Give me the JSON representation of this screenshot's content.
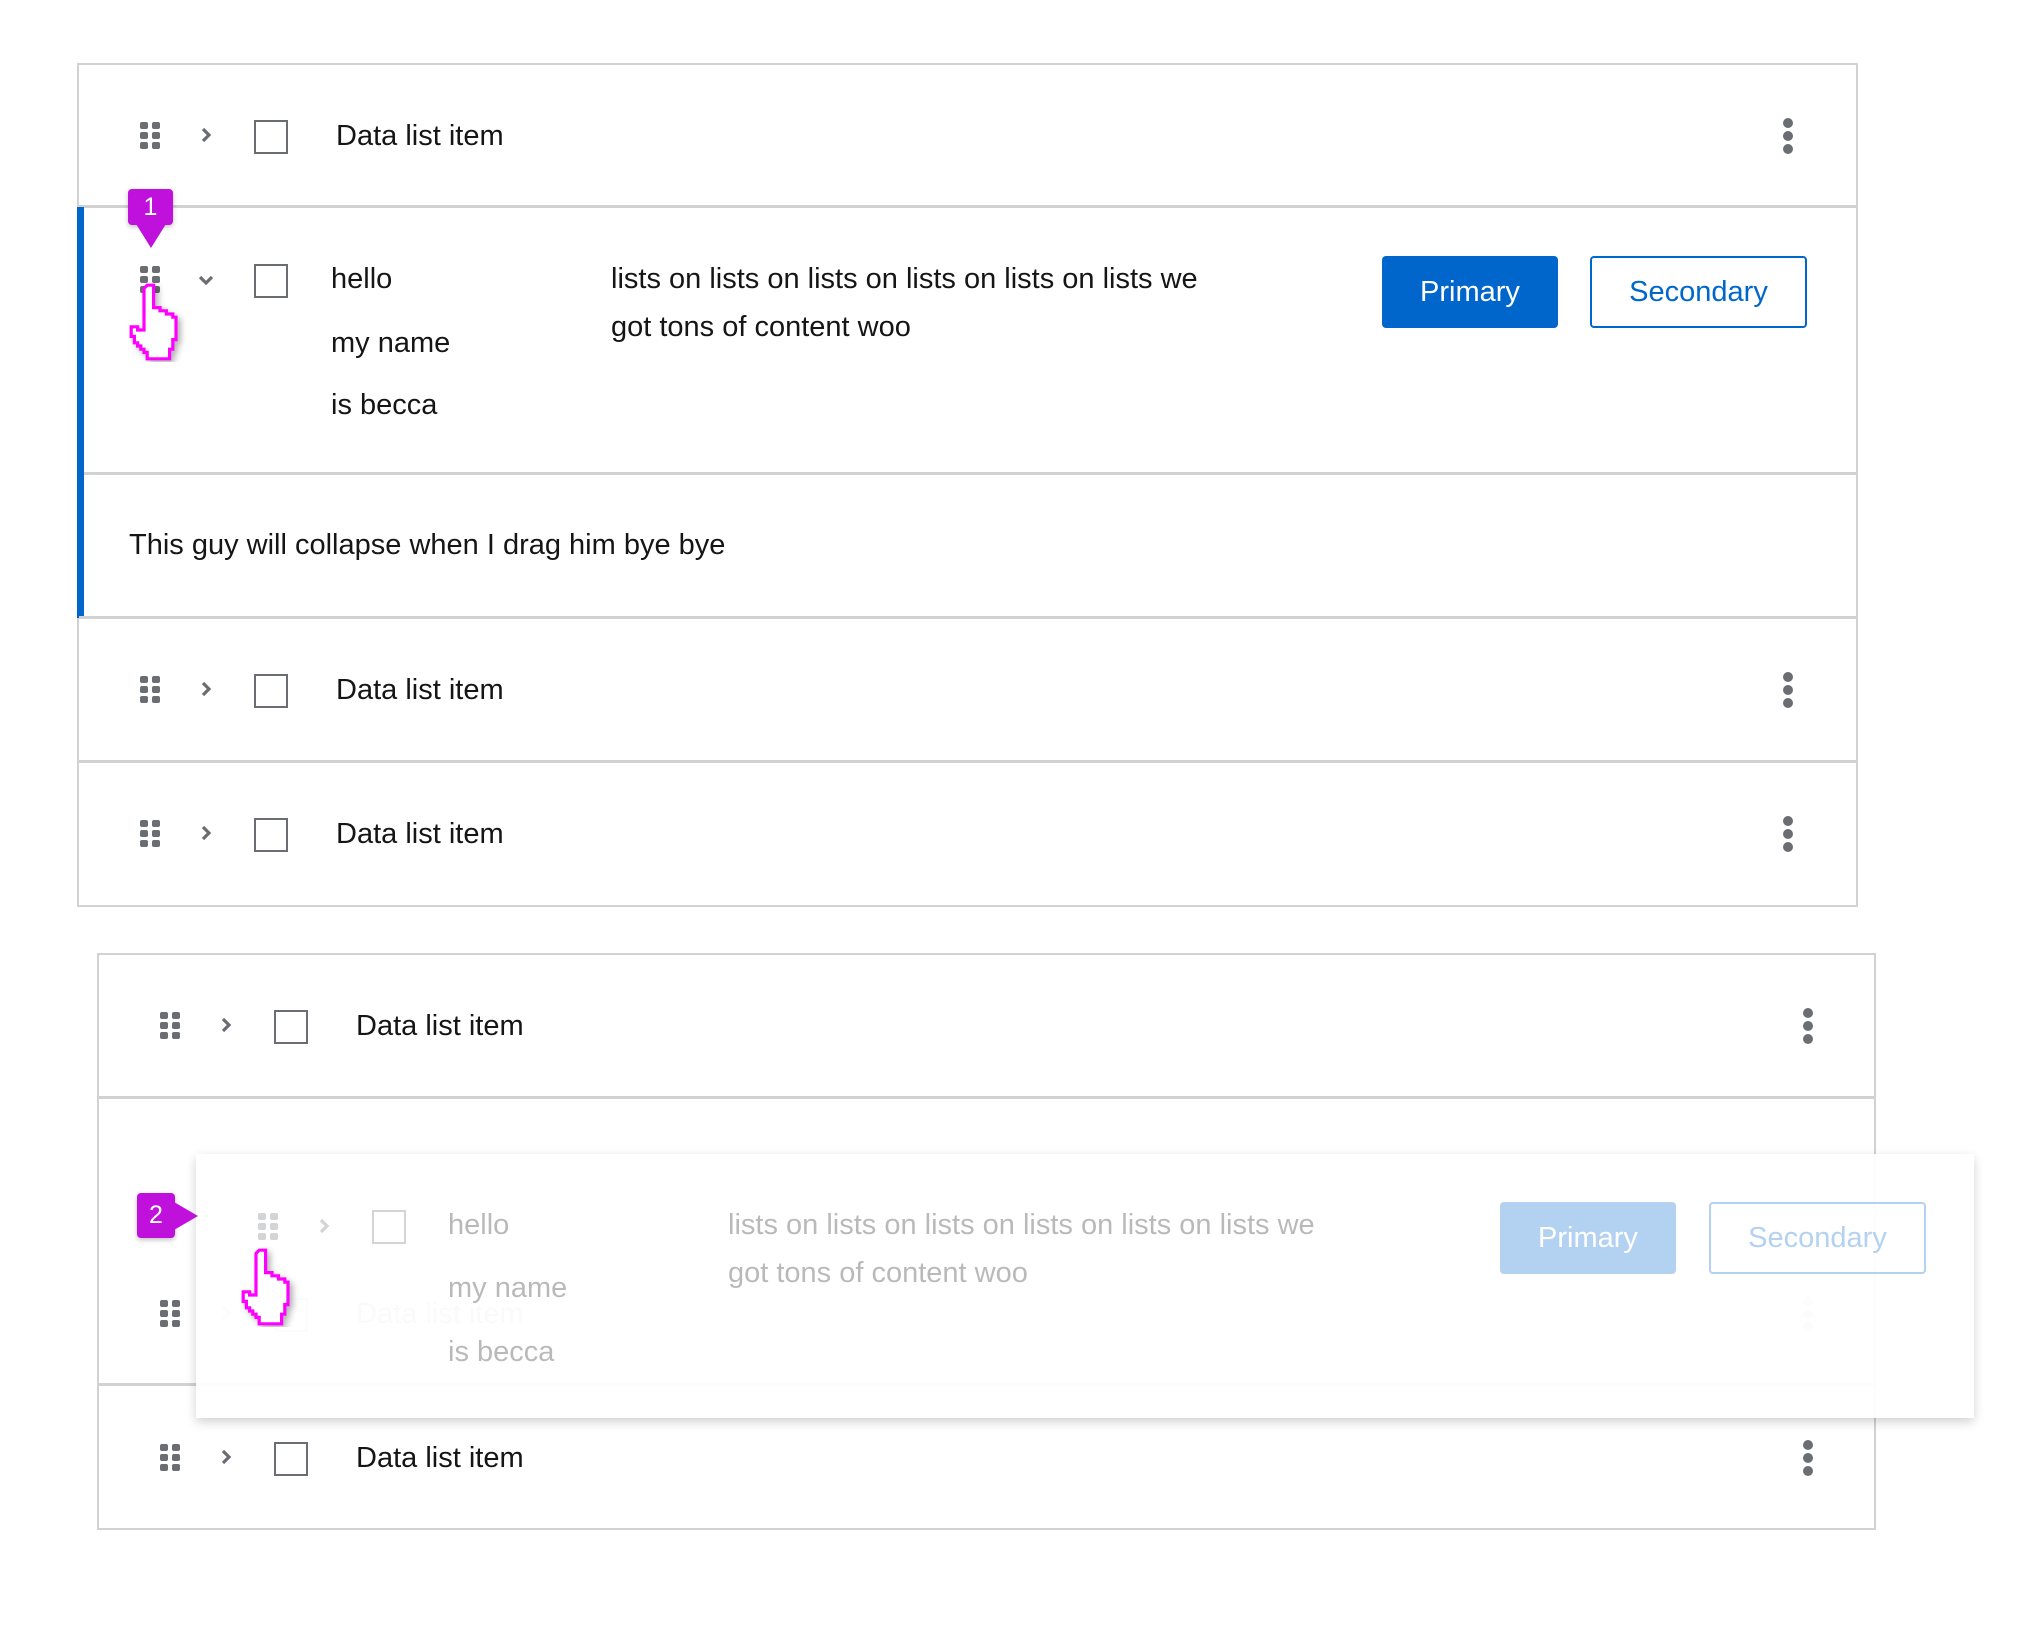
{
  "annotations": {
    "step1": "1",
    "step2": "2"
  },
  "list1": {
    "rows": [
      {
        "label": "Data list item",
        "expanded": false
      },
      {
        "expanded": true,
        "name_lines": [
          "hello",
          "my name",
          "is becca"
        ],
        "content": [
          "lists on lists on lists on lists on lists on lists we",
          "got tons of content woo"
        ],
        "primary_label": "Primary",
        "secondary_label": "Secondary",
        "expanded_content": "This guy will collapse when I drag him bye bye"
      },
      {
        "label": "Data list item",
        "expanded": false
      },
      {
        "label": "Data list item",
        "expanded": false
      }
    ]
  },
  "list2": {
    "rows": [
      {
        "label": "Data list item"
      },
      {
        "label": "Data list item",
        "placeholder": true
      },
      {
        "label": "Data list item"
      }
    ],
    "dragged": {
      "name_lines": [
        "hello",
        "my name",
        "is becca"
      ],
      "content": [
        "lists on lists on lists on lists on lists on lists we",
        "got tons of content woo"
      ],
      "primary_label": "Primary",
      "secondary_label": "Secondary"
    }
  },
  "colors": {
    "accent": "#0066cc",
    "annotation": "#c010dc",
    "border": "#d2d2d2",
    "icon": "#6a6e73"
  }
}
